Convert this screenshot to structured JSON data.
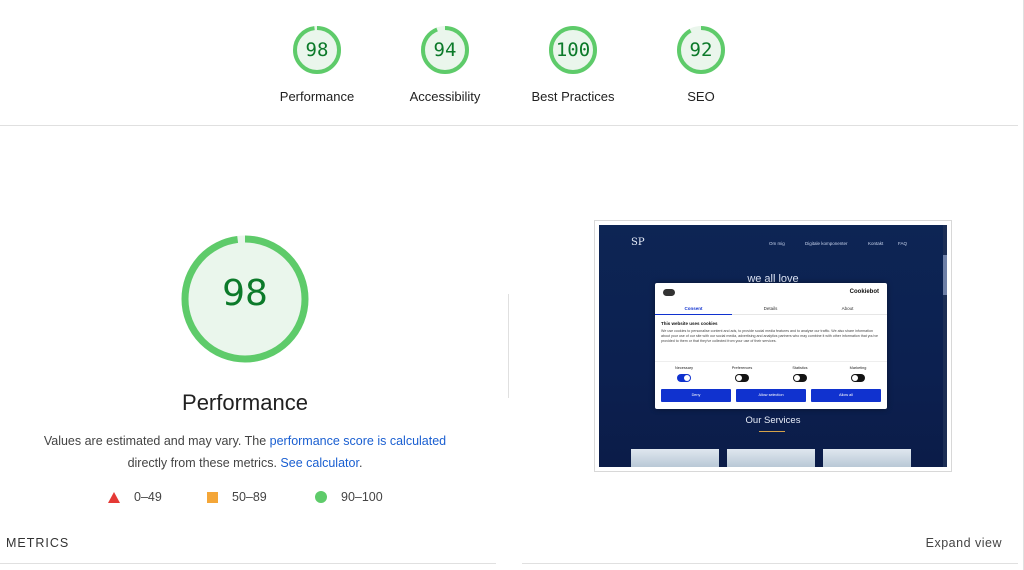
{
  "categories": [
    {
      "score": "98",
      "label": "Performance",
      "fraction": 0.98
    },
    {
      "score": "94",
      "label": "Accessibility",
      "fraction": 0.94
    },
    {
      "score": "100",
      "label": "Best Practices",
      "fraction": 1.0
    },
    {
      "score": "92",
      "label": "SEO",
      "fraction": 0.92
    }
  ],
  "main": {
    "score": "98",
    "fraction": 0.98,
    "title": "Performance",
    "desc_prefix": "Values are estimated and may vary. The ",
    "desc_link1": "performance score is calculated",
    "desc_middle": " directly from these metrics. ",
    "desc_link2": "See calculator",
    "desc_suffix": "."
  },
  "legend": [
    {
      "range": "0–49",
      "shape": "triangle",
      "color": "#e53935"
    },
    {
      "range": "50–89",
      "shape": "square",
      "color": "#f4a638"
    },
    {
      "range": "90–100",
      "shape": "circle",
      "color": "#5ecb6a"
    }
  ],
  "screenshot": {
    "nav_items": [
      "Om mig",
      "Digitale komponenter",
      "Kontakt",
      "FAQ"
    ],
    "hero_text": "we all love",
    "dialog": {
      "brand": "Cookiebot",
      "tabs": [
        "Consent",
        "Details",
        "About"
      ],
      "title": "This website uses cookies",
      "body": "We use cookies to personalise content and ads, to provide social media features and to analyse our traffic. We also share information about your use of our site with our social media, advertising and analytics partners who may combine it with other information that you've provided to them or that they've collected from your use of their services.",
      "toggles": [
        "Necessary",
        "Preferences",
        "Statistics",
        "Marketing"
      ],
      "buttons": [
        "Deny",
        "Allow selection",
        "Allow all"
      ]
    },
    "services_title": "Our Services"
  },
  "footer": {
    "metrics_label": "METRICS",
    "expand_label": "Expand view"
  },
  "colors": {
    "pass_ring": "#5ecb6a",
    "pass_text": "#0c7a2a",
    "pass_fill": "#eaf6ec",
    "link": "#1a5fd1"
  }
}
